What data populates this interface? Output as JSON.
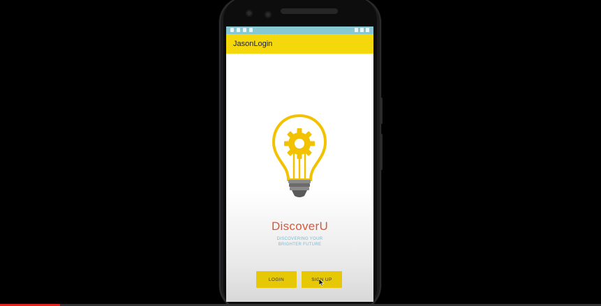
{
  "app": {
    "title": "JasonLogin",
    "brand_name": "DiscoverU",
    "tagline_line1": "DISCOVERING YOUR",
    "tagline_line2": "BRIGHTER FUTURE"
  },
  "buttons": {
    "login_label": "LOGIN",
    "signup_label": "SIGN UP"
  },
  "icons": {
    "logo": "lightbulb-gear-icon"
  },
  "colors": {
    "app_bar": "#f4d80c",
    "status_bar": "#86c9d4",
    "brand_text": "#d9573a",
    "tagline_text": "#78b9d6",
    "button": "#e7c807",
    "bulb_outline": "#f2c200",
    "bulb_base": "#6b6b6b"
  },
  "video_progress": {
    "fraction": 0.1
  }
}
